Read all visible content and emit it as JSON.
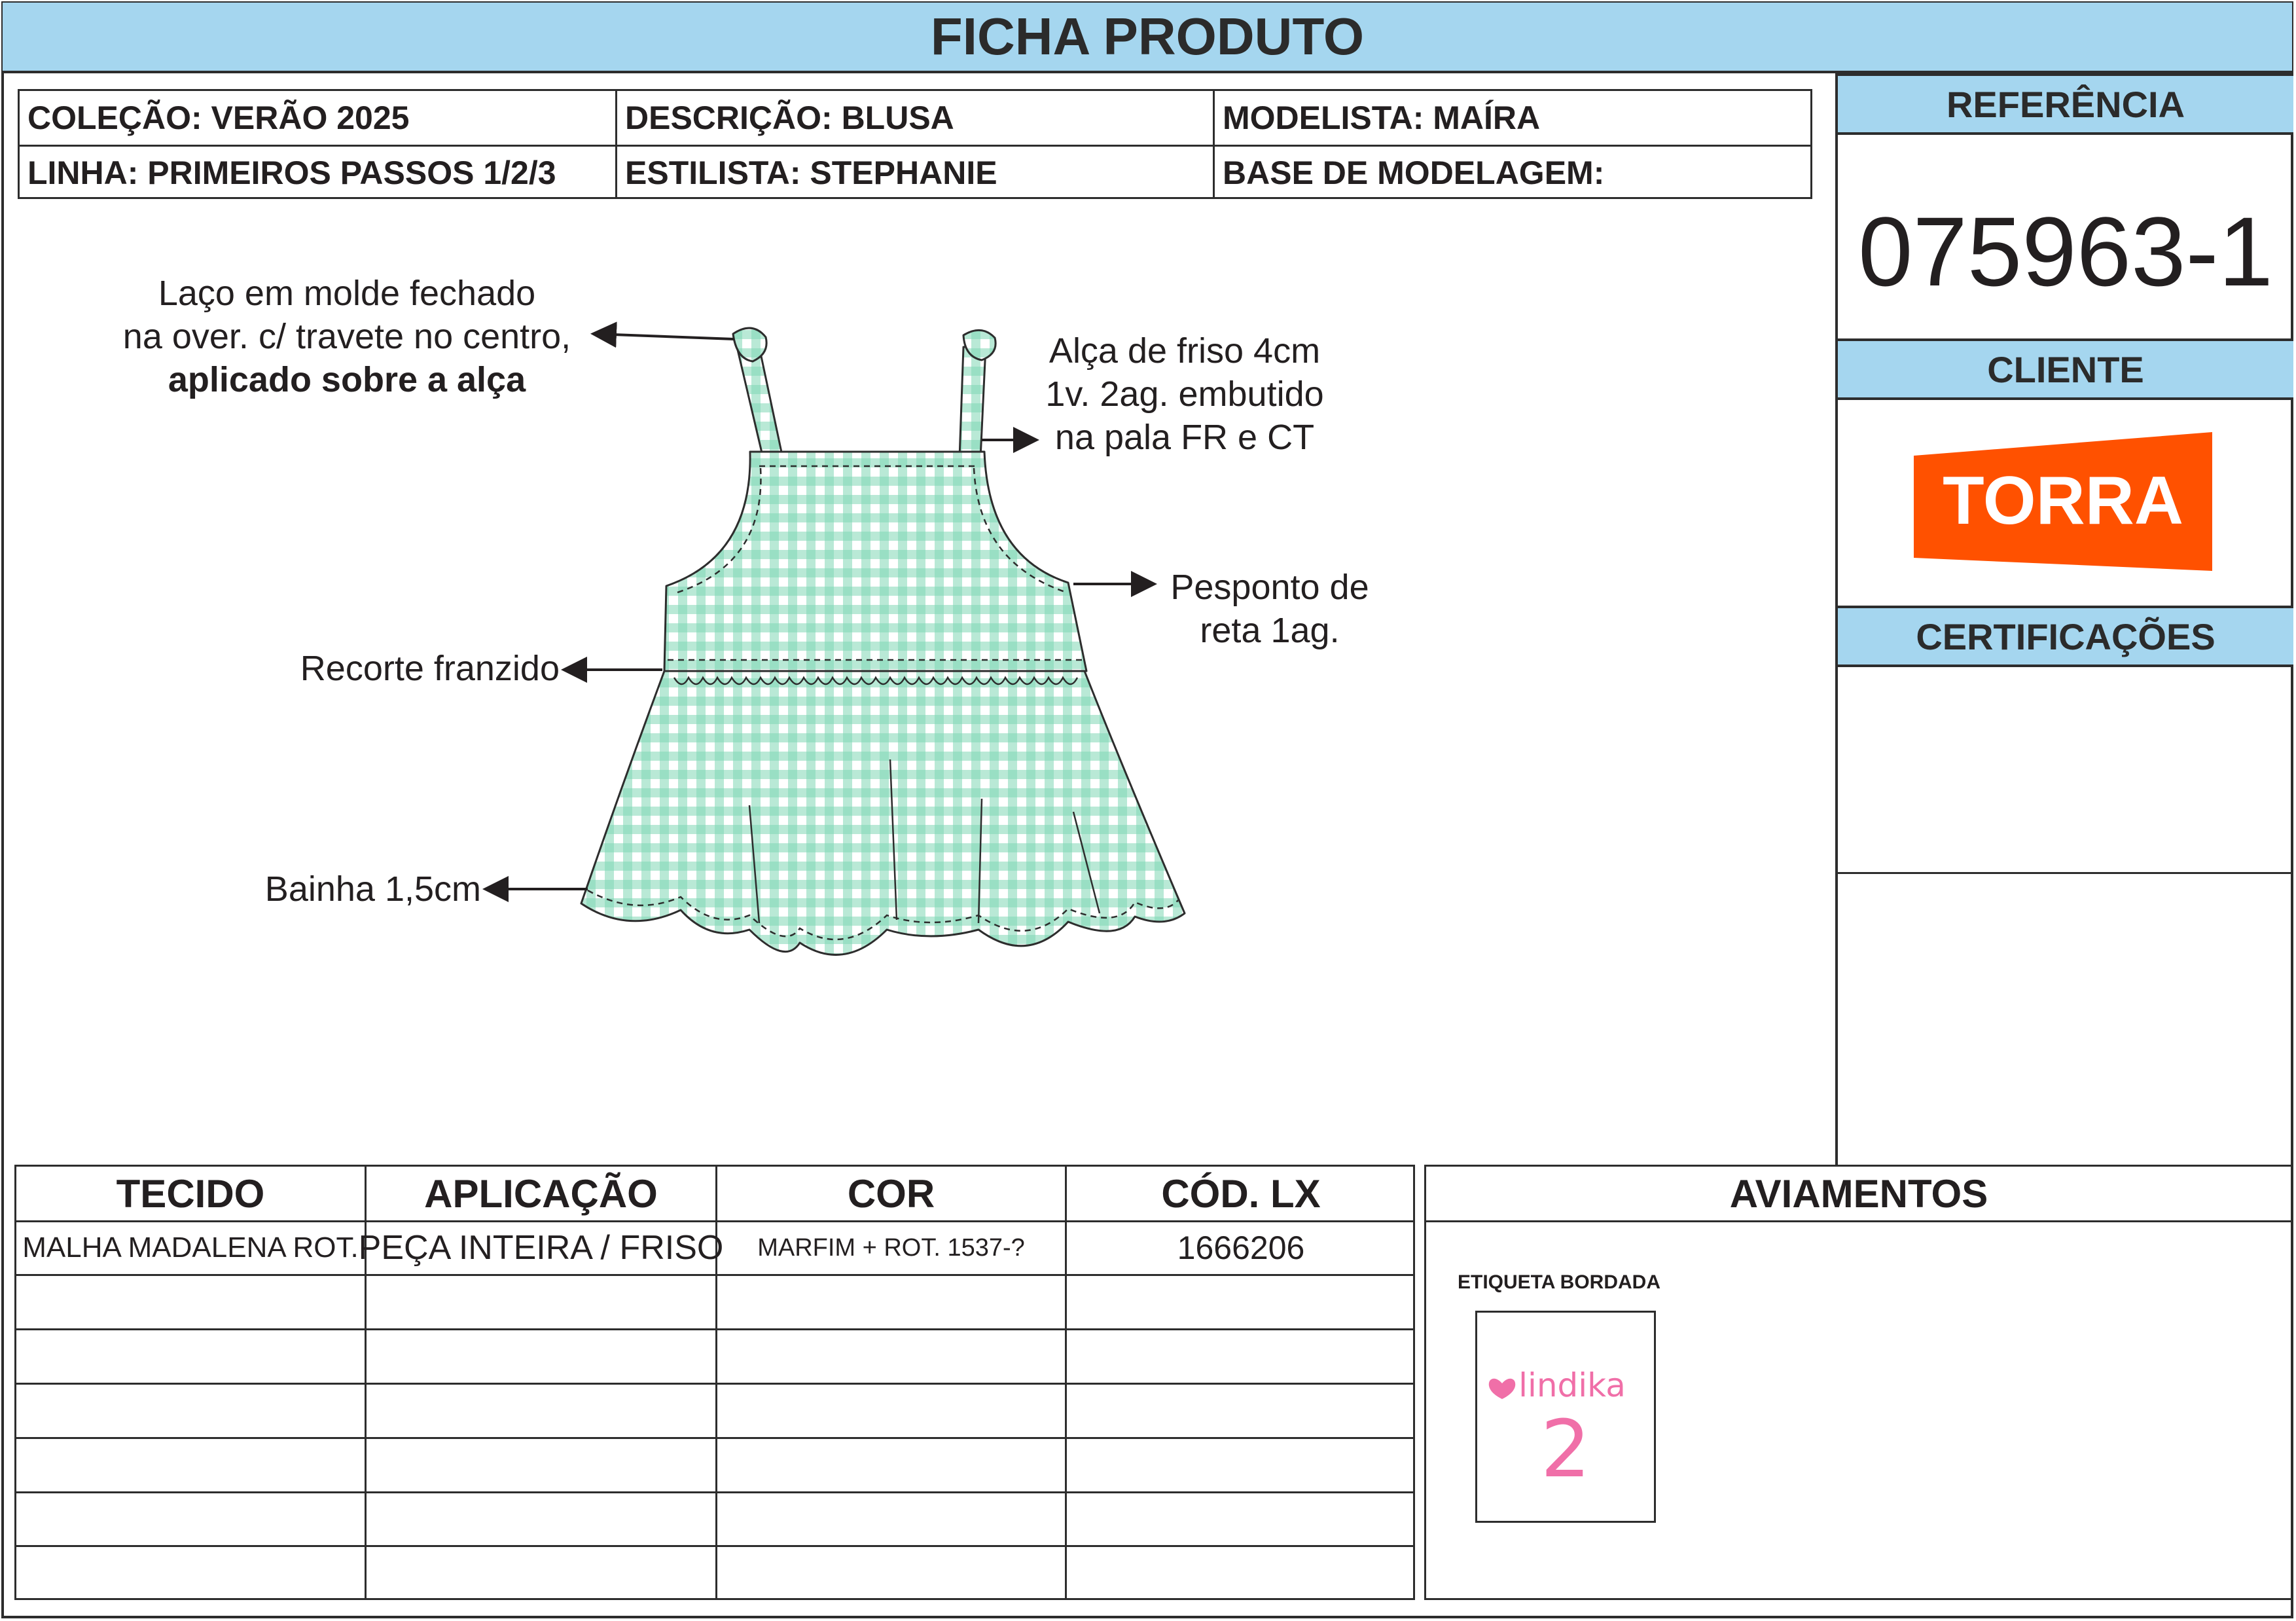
{
  "header": {
    "title": "FICHA PRODUTO"
  },
  "info": {
    "colecao": "COLEÇÃO: VERÃO 2025",
    "descricao": "DESCRIÇÃO: BLUSA",
    "modelista": "MODELISTA: MAÍRA",
    "linha": "LINHA: PRIMEIROS PASSOS 1/2/3",
    "estilista": "ESTILISTA: STEPHANIE",
    "base": "BASE DE MODELAGEM:"
  },
  "right_panel": {
    "referencia_label": "REFERÊNCIA",
    "referencia_value": "075963-1",
    "cliente_label": "CLIENTE",
    "cliente_logo_text": "TORRA",
    "certificacoes_label": "CERTIFICAÇÕES"
  },
  "annotations": {
    "laco_line1": "Laço em molde fechado",
    "laco_line2": "na over. c/ travete no centro,",
    "laco_line3": "aplicado sobre a alça",
    "alca_line1": "Alça de friso 4cm",
    "alca_line2": "1v. 2ag. embutido",
    "alca_line3": "na pala FR e CT",
    "pesponto_line1": "Pesponto de",
    "pesponto_line2": "reta 1ag.",
    "recorte": "Recorte franzido",
    "bainha": "Bainha 1,5cm"
  },
  "fabric_table": {
    "headers": [
      "TECIDO",
      "APLICAÇÃO",
      "COR",
      "CÓD. LX"
    ],
    "rows": [
      [
        "MALHA MADALENA ROT.",
        "PEÇA INTEIRA / FRISO",
        "MARFIM + ROT. 1537-?",
        "1666206"
      ]
    ]
  },
  "aviamentos": {
    "title": "AVIAMENTOS",
    "item_label": "ETIQUETA BORDADA",
    "label_brand": "lindika",
    "label_size": "2"
  },
  "colors": {
    "header_blue": "#a5d6ef",
    "torra_orange": "#ff5100",
    "gingham_green": "#7fd6b4",
    "label_pink": "#f06fa8"
  }
}
